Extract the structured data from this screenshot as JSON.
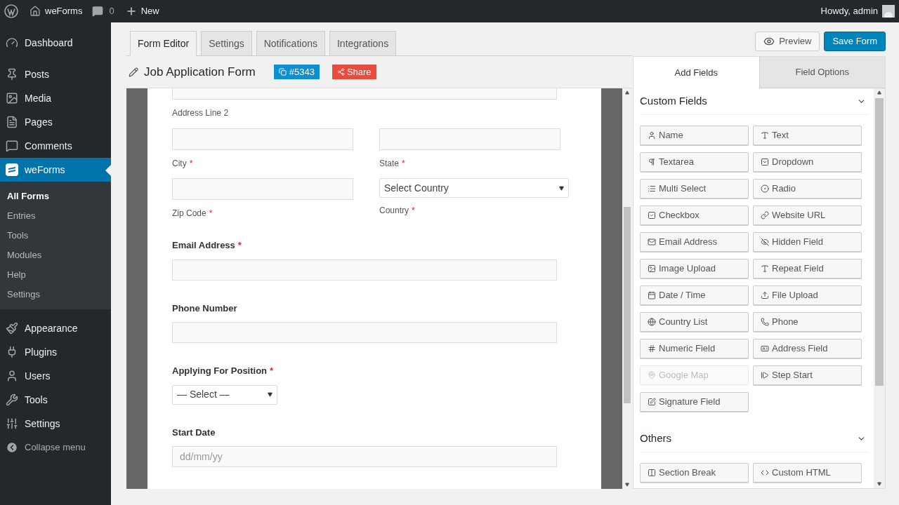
{
  "admin_bar": {
    "site": "weForms",
    "comments": "0",
    "new": "New",
    "howdy": "Howdy, admin"
  },
  "sidebar": {
    "items": [
      {
        "label": "Dashboard",
        "selected": false
      },
      {
        "label": "Posts",
        "selected": false
      },
      {
        "label": "Media",
        "selected": false
      },
      {
        "label": "Pages",
        "selected": false
      },
      {
        "label": "Comments",
        "selected": false
      },
      {
        "label": "weForms",
        "selected": true,
        "children": [
          {
            "label": "All Forms",
            "selected": true
          },
          {
            "label": "Entries",
            "selected": false
          },
          {
            "label": "Tools",
            "selected": false
          },
          {
            "label": "Modules",
            "selected": false
          },
          {
            "label": "Help",
            "selected": false
          },
          {
            "label": "Settings",
            "selected": false
          }
        ]
      },
      {
        "label": "Appearance",
        "selected": false
      },
      {
        "label": "Plugins",
        "selected": false
      },
      {
        "label": "Users",
        "selected": false
      },
      {
        "label": "Tools",
        "selected": false
      },
      {
        "label": "Settings",
        "selected": false
      }
    ],
    "collapse": "Collapse menu"
  },
  "tabs": [
    {
      "label": "Form Editor",
      "selected": true
    },
    {
      "label": "Settings",
      "selected": false
    },
    {
      "label": "Notifications",
      "selected": false
    },
    {
      "label": "Integrations",
      "selected": false
    }
  ],
  "form_title": "Job Application Form",
  "form_id": "#5343",
  "share": "Share",
  "preview": "Preview",
  "save": "Save Form",
  "form": {
    "required_mark": "*",
    "top_sublabel": "Address Line 2",
    "address_rows": [
      [
        {
          "kind": "input",
          "sublabel": "City",
          "required": true
        },
        {
          "kind": "input",
          "sublabel": "State",
          "required": true
        }
      ],
      [
        {
          "kind": "input",
          "sublabel": "Zip Code",
          "required": true
        },
        {
          "kind": "select",
          "value": "Select Country",
          "sublabel": "Country",
          "required": true
        }
      ]
    ],
    "fields": [
      {
        "kind": "input",
        "label": "Email Address",
        "required": true
      },
      {
        "kind": "input",
        "label": "Phone Number",
        "required": false
      },
      {
        "kind": "select",
        "label": "Applying For Position",
        "required": true,
        "value": "— Select —"
      },
      {
        "kind": "input",
        "label": "Start Date",
        "required": false,
        "placeholder": "dd/mm/yy"
      }
    ]
  },
  "panel_tabs": [
    {
      "label": "Add Fields",
      "selected": true
    },
    {
      "label": "Field Options",
      "selected": false
    }
  ],
  "sections": [
    {
      "title": "Custom Fields",
      "expanded": true,
      "fields": [
        {
          "label": "Name",
          "disabled": false
        },
        {
          "label": "Text",
          "disabled": false
        },
        {
          "label": "Textarea",
          "disabled": false
        },
        {
          "label": "Dropdown",
          "disabled": false
        },
        {
          "label": "Multi Select",
          "disabled": false
        },
        {
          "label": "Radio",
          "disabled": false
        },
        {
          "label": "Checkbox",
          "disabled": false
        },
        {
          "label": "Website URL",
          "disabled": false
        },
        {
          "label": "Email Address",
          "disabled": false
        },
        {
          "label": "Hidden Field",
          "disabled": false
        },
        {
          "label": "Image Upload",
          "disabled": false
        },
        {
          "label": "Repeat Field",
          "disabled": false
        },
        {
          "label": "Date / Time",
          "disabled": false
        },
        {
          "label": "File Upload",
          "disabled": false
        },
        {
          "label": "Country List",
          "disabled": false
        },
        {
          "label": "Phone",
          "disabled": false
        },
        {
          "label": "Numeric Field",
          "disabled": false
        },
        {
          "label": "Address Field",
          "disabled": false
        },
        {
          "label": "Google Map",
          "disabled": true
        },
        {
          "label": "Step Start",
          "disabled": false
        },
        {
          "label": "Signature Field",
          "disabled": false
        }
      ]
    },
    {
      "title": "Others",
      "expanded": true,
      "fields": [
        {
          "label": "Section Break",
          "disabled": false
        },
        {
          "label": "Custom HTML",
          "disabled": false
        }
      ]
    }
  ]
}
